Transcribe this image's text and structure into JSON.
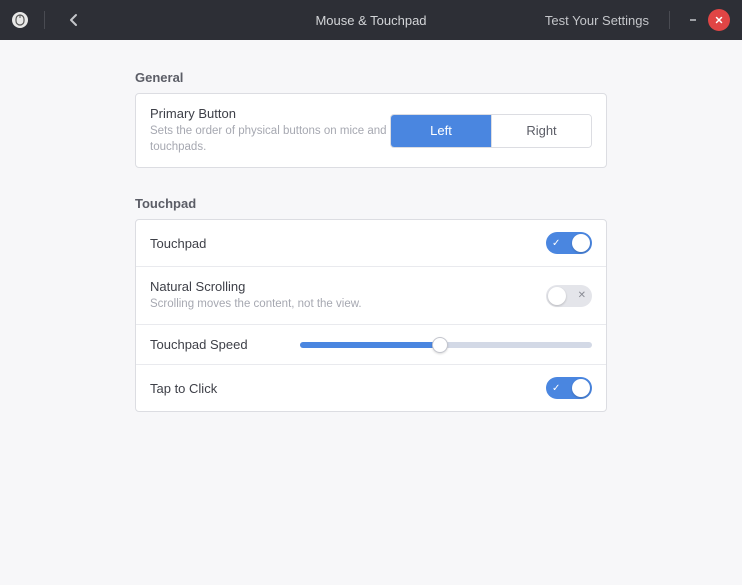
{
  "titlebar": {
    "title": "Mouse & Touchpad",
    "test_label": "Test Your Settings"
  },
  "sections": {
    "general": {
      "header": "General",
      "primary_button": {
        "title": "Primary Button",
        "desc": "Sets the order of physical buttons on mice and touchpads.",
        "left": "Left",
        "right": "Right",
        "selected": "left"
      }
    },
    "touchpad": {
      "header": "Touchpad",
      "touchpad_row": {
        "title": "Touchpad",
        "enabled": true
      },
      "natural_scrolling": {
        "title": "Natural Scrolling",
        "desc": "Scrolling moves the content, not the view.",
        "enabled": false
      },
      "speed": {
        "title": "Touchpad Speed",
        "value": 48
      },
      "tap_to_click": {
        "title": "Tap to Click",
        "enabled": true
      }
    }
  }
}
